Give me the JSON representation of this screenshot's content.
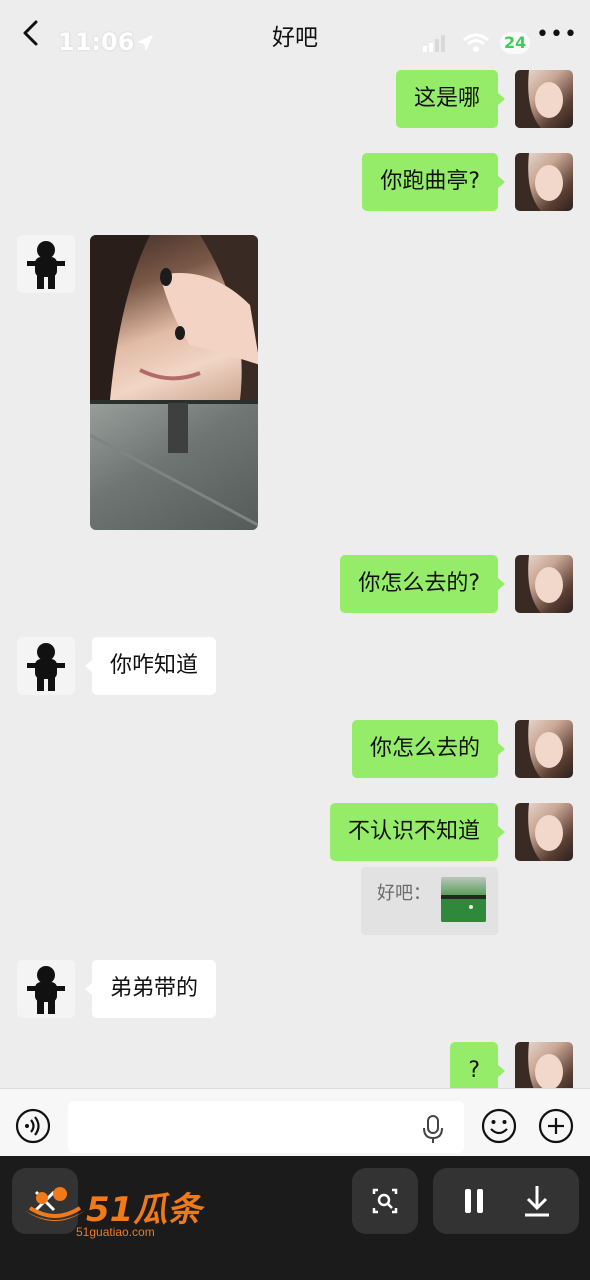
{
  "status_bar": {
    "time": "11:06",
    "battery": "24"
  },
  "header": {
    "title": "好吧"
  },
  "messages": {
    "m1": "这是哪",
    "m2": "你跑曲亭?",
    "m4": "你怎么去的?",
    "m5": "你咋知道",
    "m6": "你怎么去的",
    "m7": "不认识不知道",
    "quote": "好吧：",
    "m8": "弟弟带的",
    "m9": "?"
  },
  "watermark": {
    "brand": "51瓜条",
    "site": "51guatiao.com"
  },
  "colors": {
    "bubble_me": "#95ec69",
    "bubble_other": "#ffffff",
    "background": "#ededed",
    "brand": "#f07a1a"
  }
}
